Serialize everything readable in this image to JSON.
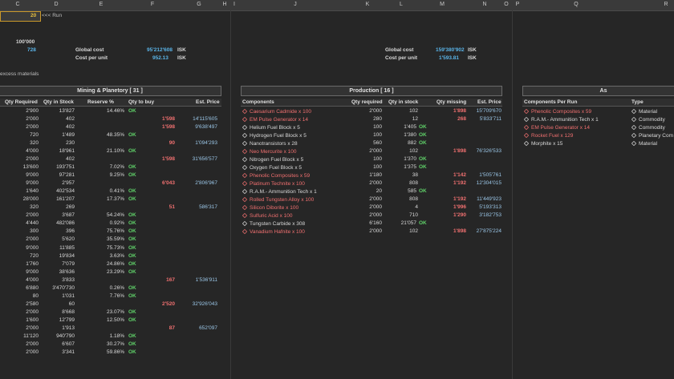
{
  "columns": [
    "C",
    "D",
    "E",
    "F",
    "G",
    "H",
    "I",
    "J",
    "K",
    "L",
    "M",
    "N",
    "O",
    "P",
    "Q",
    "R"
  ],
  "top": {
    "run_value": "20",
    "run_label": "<<< Run",
    "qty_total": "100'000",
    "qty_sub": "728",
    "excess_label": "excess materials"
  },
  "cost_left": {
    "global_label": "Global cost",
    "global_value": "95'212'608",
    "global_unit": "ISK",
    "unit_label": "Cost per unit",
    "unit_value": "952.13",
    "unit_unit": "ISK"
  },
  "cost_right": {
    "global_label": "Global cost",
    "global_value": "159'380'902",
    "global_unit": "ISK",
    "unit_label": "Cost per unit",
    "unit_value": "1'593.81",
    "unit_unit": "ISK"
  },
  "mining": {
    "title": "Mining & Planetory  [ 31 ]",
    "headers": [
      "Qty Required",
      "Qty in Stock",
      "Reserve %",
      "Qty to buy",
      "Est. Price"
    ],
    "rows": [
      [
        "2'900",
        "13'827",
        "14.46%",
        "OK",
        ""
      ],
      [
        "2'000",
        "402",
        "",
        "1'598",
        "14'115'605"
      ],
      [
        "2'000",
        "402",
        "",
        "1'598",
        "9'638'497"
      ],
      [
        "720",
        "1'489",
        "48.35%",
        "OK",
        ""
      ],
      [
        "320",
        "230",
        "",
        "90",
        "1'094'293"
      ],
      [
        "4'000",
        "18'961",
        "21.10%",
        "OK",
        ""
      ],
      [
        "2'000",
        "402",
        "",
        "1'598",
        "31'656'577"
      ],
      [
        "13'600",
        "193'751",
        "7.02%",
        "OK",
        ""
      ],
      [
        "9'000",
        "97'281",
        "9.25%",
        "OK",
        ""
      ],
      [
        "9'000",
        "2'957",
        "",
        "6'043",
        "2'806'967"
      ],
      [
        "1'640",
        "402'534",
        "0.41%",
        "OK",
        ""
      ],
      [
        "28'000",
        "161'207",
        "17.37%",
        "OK",
        ""
      ],
      [
        "320",
        "269",
        "",
        "51",
        "586'317"
      ],
      [
        "2'000",
        "3'687",
        "54.24%",
        "OK",
        ""
      ],
      [
        "4'440",
        "482'086",
        "0.92%",
        "OK",
        ""
      ],
      [
        "300",
        "396",
        "75.76%",
        "OK",
        ""
      ],
      [
        "2'000",
        "5'620",
        "35.59%",
        "OK",
        ""
      ],
      [
        "9'000",
        "11'885",
        "75.73%",
        "OK",
        ""
      ],
      [
        "720",
        "19'834",
        "3.63%",
        "OK",
        ""
      ],
      [
        "1'760",
        "7'079",
        "24.86%",
        "OK",
        ""
      ],
      [
        "9'000",
        "38'636",
        "23.29%",
        "OK",
        ""
      ],
      [
        "4'000",
        "3'833",
        "",
        "167",
        "1'536'911"
      ],
      [
        "6'880",
        "3'470'730",
        "0.26%",
        "OK",
        ""
      ],
      [
        "80",
        "1'031",
        "7.76%",
        "OK",
        ""
      ],
      [
        "2'580",
        "60",
        "",
        "2'520",
        "32'926'043"
      ],
      [
        "2'000",
        "8'668",
        "23.07%",
        "OK",
        ""
      ],
      [
        "1'600",
        "12'799",
        "12.50%",
        "OK",
        ""
      ],
      [
        "2'000",
        "1'913",
        "",
        "87",
        "652'097"
      ],
      [
        "11'120",
        "940'790",
        "1.18%",
        "OK",
        ""
      ],
      [
        "2'000",
        "6'607",
        "30.27%",
        "OK",
        ""
      ],
      [
        "2'000",
        "3'341",
        "59.86%",
        "OK",
        ""
      ]
    ]
  },
  "production": {
    "title": "Production  [ 16 ]",
    "headers": [
      "Components",
      "Qty required",
      "Qty in stock",
      "Qty missing",
      "Est. Price"
    ],
    "rows": [
      [
        "Caesarium Cadmide x 100",
        "2'000",
        "102",
        "1'898",
        "15'709'670",
        true
      ],
      [
        "EM Pulse Generator x 14",
        "280",
        "12",
        "268",
        "5'833'711",
        true
      ],
      [
        "Helium Fuel Block x 5",
        "100",
        "1'405",
        "OK",
        "",
        false
      ],
      [
        "Hydrogen Fuel Block x 5",
        "100",
        "1'380",
        "OK",
        "",
        false
      ],
      [
        "Nanotransistors x 28",
        "560",
        "882",
        "OK",
        "",
        false
      ],
      [
        "Neo Mercurite x 100",
        "2'000",
        "102",
        "1'898",
        "76'326'533",
        true
      ],
      [
        "Nitrogen Fuel Block x 5",
        "100",
        "1'370",
        "OK",
        "",
        false
      ],
      [
        "Oxygen Fuel Block x 5",
        "100",
        "1'375",
        "OK",
        "",
        false
      ],
      [
        "Phenolic Composites x 59",
        "1'180",
        "38",
        "1'142",
        "1'505'761",
        true
      ],
      [
        "Platinum Technite x 100",
        "2'000",
        "808",
        "1'192",
        "12'304'015",
        true
      ],
      [
        "R.A.M.- Ammunition Tech x 1",
        "20",
        "585",
        "OK",
        "",
        false
      ],
      [
        "Rolled Tungsten Alloy x 100",
        "2'000",
        "808",
        "1'192",
        "11'449'923",
        true
      ],
      [
        "Silicon Diborite x 100",
        "2'000",
        "4",
        "1'996",
        "5'193'313",
        true
      ],
      [
        "Sulfuric Acid x 100",
        "2'000",
        "710",
        "1'290",
        "3'182'753",
        true
      ],
      [
        "Tungsten Carbide x 308",
        "6'160",
        "21'057",
        "OK",
        "",
        false
      ],
      [
        "Vanadium Hafnite x 100",
        "2'000",
        "102",
        "1'898",
        "27'875'224",
        true
      ]
    ]
  },
  "assembly": {
    "title": "As",
    "headers": [
      "Components  Per Run",
      "Type"
    ],
    "rows": [
      [
        "Phenolic Composites x 59",
        "Material",
        true
      ],
      [
        "R.A.M.- Ammunition Tech x 1",
        "Commodity",
        false
      ],
      [
        "EM Pulse Generator x 14",
        "Commodity",
        true
      ],
      [
        "Rocket Fuel x 129",
        "Planetary Com",
        true
      ],
      [
        "Morphite x 15",
        "Material",
        false
      ]
    ]
  }
}
